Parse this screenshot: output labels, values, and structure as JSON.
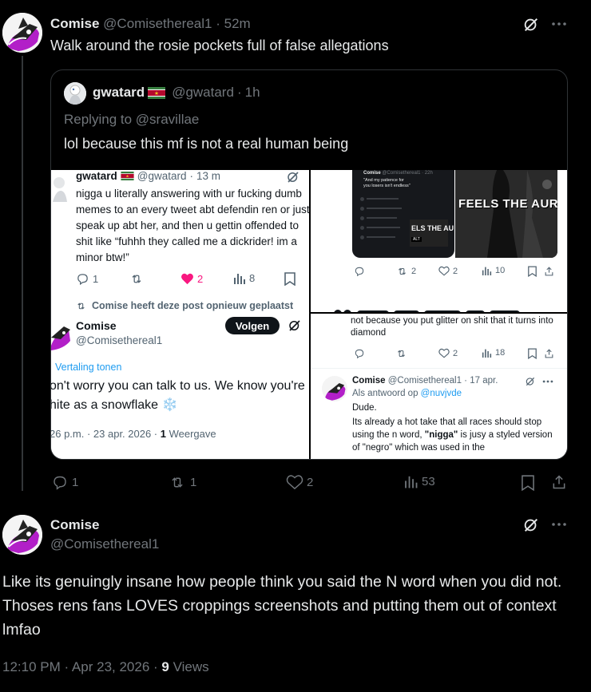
{
  "post1": {
    "author": "Comise",
    "handle": "@Comisethereal1",
    "time": "52m",
    "text": "Walk around the rosie pockets full of false allegations",
    "stats": {
      "replies": "1",
      "reposts": "1",
      "likes": "2",
      "views": "53"
    }
  },
  "quote": {
    "author": "gwatard",
    "handle": "@gwatard",
    "time": "1h",
    "replying_to": "Replying to @sravillae",
    "text": "lol because this mf is not a real human being"
  },
  "img1": {
    "author": "gwatard",
    "handle": "@gwatard",
    "time": "13 m",
    "text": "nigga u literally answering with ur fucking dumb memes to an every tweet abt defendin ren or just speak up abt her, and then u gettin offended to shit like “fuhhh they called me a dickrider! im a minor btw!”",
    "stats": {
      "replies": "1",
      "likes": "2",
      "views": "8"
    },
    "reposted_label": "Comise heeft deze post opnieuw geplaatst",
    "author2": "Comise",
    "handle2": "@Comisethereal1",
    "follow_label": "Volgen",
    "translate_label": "Vertaling tonen",
    "text2_line1": "on't worry you can talk to us. We know you're",
    "text2_line2": "hite as a snowflake ❄️",
    "meta_prefix": "26 p.m. · 23 apr. 2026 · ",
    "meta_count": "1",
    "meta_suffix": " Weergave"
  },
  "img2": {
    "mini_author": "Comise",
    "mini_handle": "@Comisethereal1 · 22h",
    "mini_text": "\"And my patience for you losers isn't endless\"",
    "video_caption": "FEELS THE AURA",
    "video_caption_small": "ELS THE AU",
    "alt_label": "ALT",
    "stats": {
      "reposts": "2",
      "likes": "2",
      "views": "10"
    },
    "bottom_text": "•• ·· ·· ·· · ·· ·· ·"
  },
  "img3": {
    "top_text": "not because you put glitter on shit that it turns into diamond",
    "stats": {
      "likes": "2",
      "views": "18"
    },
    "author": "Comise",
    "handle": "@Comisethereal1",
    "time": "17 apr.",
    "reply_to_prefix": "Als antwoord op ",
    "reply_to_handle": "@nuvjvde",
    "text_dude": "Dude.",
    "text_body_1": "Its already a hot take that all races should stop using the n word, ",
    "text_bold": "\"nigga\"",
    "text_body_2": " is jusy a styled version of \"negro\" which was used in the"
  },
  "post2": {
    "author": "Comise",
    "handle": "@Comisethereal1",
    "text": "Like its genuingly insane how people think you said the N word when you did not. Thoses rens fans LOVES croppings screenshots and putting them out of context lmfao",
    "time": "12:10 PM · Apr 23, 2026 · ",
    "views_count": "9",
    "views_label": " Views"
  },
  "colors": {
    "accent": "#1d9bf0",
    "like_pink": "#f91880",
    "avatar_purple": "#b21fc8"
  }
}
